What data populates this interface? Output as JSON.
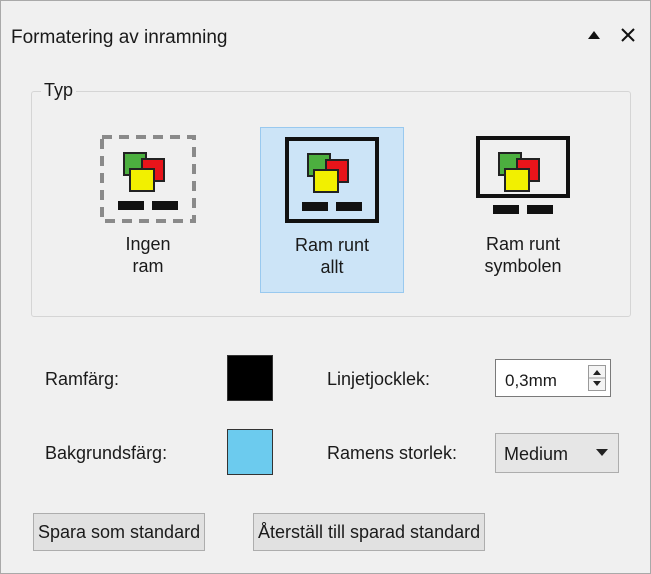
{
  "panel": {
    "title": "Formatering av inramning",
    "collapse_glyph": "▲",
    "close_glyph": "✕"
  },
  "type_group": {
    "label": "Typ",
    "options": [
      {
        "label_line1": "Ingen",
        "label_line2": "ram",
        "icon": "no-frame-icon",
        "selected": false
      },
      {
        "label_line1": "Ram runt",
        "label_line2": "allt",
        "icon": "frame-all-icon",
        "selected": true
      },
      {
        "label_line1": "Ram runt",
        "label_line2": "symbolen",
        "icon": "frame-symbol-icon",
        "selected": false
      }
    ]
  },
  "frame_color": {
    "label": "Ramfärg:",
    "color": "#000000"
  },
  "background_color": {
    "label": "Bakgrundsfärg:",
    "color": "#6ccbee"
  },
  "line_thickness": {
    "label": "Linjetjocklek:",
    "value": "0,3mm"
  },
  "frame_size": {
    "label": "Ramens storlek:",
    "value": "Medium"
  },
  "buttons": {
    "save_default": "Spara som standard",
    "restore_default": "Återställ till sparad standard"
  },
  "colors": {
    "selected_bg": "#cce4f7",
    "selected_border": "#99c9ef",
    "icon_green": "#4caf3f",
    "icon_red": "#e8141a",
    "icon_yellow": "#f2f000"
  }
}
